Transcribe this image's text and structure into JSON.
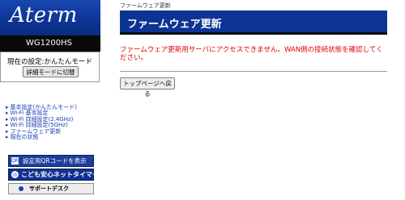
{
  "brand": {
    "logo_text": "Aterm",
    "model": "WG1200HS"
  },
  "mode": {
    "current_label": "現在の設定:かんたんモード",
    "switch_button": "詳細モードに切替"
  },
  "menu": {
    "items": [
      {
        "label": "基本設定(かんたんモード)"
      },
      {
        "label": "Wi-Fi 基本設定"
      },
      {
        "label": "Wi-Fi 詳細設定(2.4GHz)"
      },
      {
        "label": "Wi-Fi 詳細設定(5GHz)"
      },
      {
        "label": "ファームウェア更新"
      },
      {
        "label": "現在の状態"
      }
    ]
  },
  "buttons": {
    "qr": {
      "icon_text": "QR",
      "label": "設定用QRコードを表示"
    },
    "kids": {
      "icon_text": "◎",
      "label": "こども安心ネットタイマー"
    },
    "support": {
      "label": "サポートデスク"
    }
  },
  "main": {
    "breadcrumb": "ファームウェア更新",
    "title": "ファームウェア更新",
    "error": "ファームウェア更新用サーバにアクセスできません。WAN側の接続状態を確認してください。",
    "top_button": "トップページへ戻る"
  },
  "colors": {
    "brand_blue": "#0d3494",
    "error_red": "#e00000",
    "link_blue": "#1a3fb0"
  }
}
